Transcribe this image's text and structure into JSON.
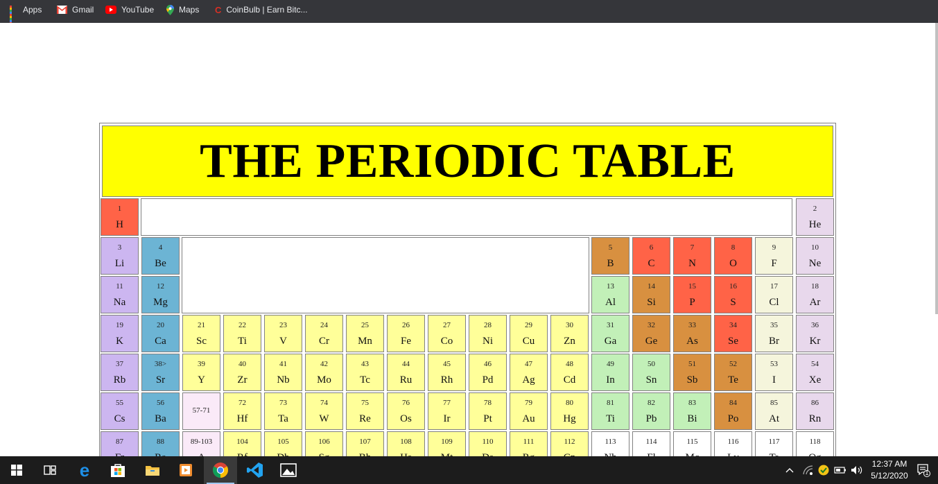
{
  "bookmarks": [
    {
      "label": "Apps",
      "icon": "apps-grid-icon"
    },
    {
      "label": "Gmail",
      "icon": "gmail-icon"
    },
    {
      "label": "YouTube",
      "icon": "youtube-icon"
    },
    {
      "label": "Maps",
      "icon": "maps-icon"
    },
    {
      "label": "CoinBulb | Earn Bitc...",
      "icon": "coinbulb-icon"
    }
  ],
  "page": {
    "title": "THE PERIODIC TABLE",
    "colors": {
      "red": "#ff6347",
      "purple": "#ccb6f0",
      "blue": "#6cb4d4",
      "yellow": "#ffff99",
      "orange": "#d89040",
      "green": "#c2f0b8",
      "cream": "#f5f5dc",
      "lavender": "#e8d8ec",
      "pink": "#faeaf8",
      "white": "#ffffff"
    },
    "elements": [
      {
        "num": "1",
        "sym": "H",
        "row": 0,
        "col": 0,
        "color": "red"
      },
      {
        "num": "2",
        "sym": "He",
        "row": 0,
        "col": 17,
        "color": "lavender"
      },
      {
        "num": "3",
        "sym": "Li",
        "row": 1,
        "col": 0,
        "color": "purple"
      },
      {
        "num": "4",
        "sym": "Be",
        "row": 1,
        "col": 1,
        "color": "blue"
      },
      {
        "num": "5",
        "sym": "B",
        "row": 1,
        "col": 12,
        "color": "orange"
      },
      {
        "num": "6",
        "sym": "C",
        "row": 1,
        "col": 13,
        "color": "red"
      },
      {
        "num": "7",
        "sym": "N",
        "row": 1,
        "col": 14,
        "color": "red"
      },
      {
        "num": "8",
        "sym": "O",
        "row": 1,
        "col": 15,
        "color": "red"
      },
      {
        "num": "9",
        "sym": "F",
        "row": 1,
        "col": 16,
        "color": "cream"
      },
      {
        "num": "10",
        "sym": "Ne",
        "row": 1,
        "col": 17,
        "color": "lavender"
      },
      {
        "num": "11",
        "sym": "Na",
        "row": 2,
        "col": 0,
        "color": "purple"
      },
      {
        "num": "12",
        "sym": "Mg",
        "row": 2,
        "col": 1,
        "color": "blue"
      },
      {
        "num": "13",
        "sym": "Al",
        "row": 2,
        "col": 12,
        "color": "green"
      },
      {
        "num": "14",
        "sym": "Si",
        "row": 2,
        "col": 13,
        "color": "orange"
      },
      {
        "num": "15",
        "sym": "P",
        "row": 2,
        "col": 14,
        "color": "red"
      },
      {
        "num": "16",
        "sym": "S",
        "row": 2,
        "col": 15,
        "color": "red"
      },
      {
        "num": "17",
        "sym": "Cl",
        "row": 2,
        "col": 16,
        "color": "cream"
      },
      {
        "num": "18",
        "sym": "Ar",
        "row": 2,
        "col": 17,
        "color": "lavender"
      },
      {
        "num": "19",
        "sym": "K",
        "row": 3,
        "col": 0,
        "color": "purple"
      },
      {
        "num": "20",
        "sym": "Ca",
        "row": 3,
        "col": 1,
        "color": "blue"
      },
      {
        "num": "21",
        "sym": "Sc",
        "row": 3,
        "col": 2,
        "color": "yellow"
      },
      {
        "num": "22",
        "sym": "Ti",
        "row": 3,
        "col": 3,
        "color": "yellow"
      },
      {
        "num": "23",
        "sym": "V",
        "row": 3,
        "col": 4,
        "color": "yellow"
      },
      {
        "num": "24",
        "sym": "Cr",
        "row": 3,
        "col": 5,
        "color": "yellow"
      },
      {
        "num": "25",
        "sym": "Mn",
        "row": 3,
        "col": 6,
        "color": "yellow"
      },
      {
        "num": "26",
        "sym": "Fe",
        "row": 3,
        "col": 7,
        "color": "yellow"
      },
      {
        "num": "27",
        "sym": "Co",
        "row": 3,
        "col": 8,
        "color": "yellow"
      },
      {
        "num": "28",
        "sym": "Ni",
        "row": 3,
        "col": 9,
        "color": "yellow"
      },
      {
        "num": "29",
        "sym": "Cu",
        "row": 3,
        "col": 10,
        "color": "yellow"
      },
      {
        "num": "30",
        "sym": "Zn",
        "row": 3,
        "col": 11,
        "color": "yellow"
      },
      {
        "num": "31",
        "sym": "Ga",
        "row": 3,
        "col": 12,
        "color": "green"
      },
      {
        "num": "32",
        "sym": "Ge",
        "row": 3,
        "col": 13,
        "color": "orange"
      },
      {
        "num": "33",
        "sym": "As",
        "row": 3,
        "col": 14,
        "color": "orange"
      },
      {
        "num": "34",
        "sym": "Se",
        "row": 3,
        "col": 15,
        "color": "red"
      },
      {
        "num": "35",
        "sym": "Br",
        "row": 3,
        "col": 16,
        "color": "cream"
      },
      {
        "num": "36",
        "sym": "Kr",
        "row": 3,
        "col": 17,
        "color": "lavender"
      },
      {
        "num": "37",
        "sym": "Rb",
        "row": 4,
        "col": 0,
        "color": "purple"
      },
      {
        "num": "38>",
        "sym": "Sr",
        "row": 4,
        "col": 1,
        "color": "blue"
      },
      {
        "num": "39",
        "sym": "Y",
        "row": 4,
        "col": 2,
        "color": "yellow"
      },
      {
        "num": "40",
        "sym": "Zr",
        "row": 4,
        "col": 3,
        "color": "yellow"
      },
      {
        "num": "41",
        "sym": "Nb",
        "row": 4,
        "col": 4,
        "color": "yellow"
      },
      {
        "num": "42",
        "sym": "Mo",
        "row": 4,
        "col": 5,
        "color": "yellow"
      },
      {
        "num": "43",
        "sym": "Tc",
        "row": 4,
        "col": 6,
        "color": "yellow"
      },
      {
        "num": "44",
        "sym": "Ru",
        "row": 4,
        "col": 7,
        "color": "yellow"
      },
      {
        "num": "45",
        "sym": "Rh",
        "row": 4,
        "col": 8,
        "color": "yellow"
      },
      {
        "num": "46",
        "sym": "Pd",
        "row": 4,
        "col": 9,
        "color": "yellow"
      },
      {
        "num": "47",
        "sym": "Ag",
        "row": 4,
        "col": 10,
        "color": "yellow"
      },
      {
        "num": "48",
        "sym": "Cd",
        "row": 4,
        "col": 11,
        "color": "yellow"
      },
      {
        "num": "49",
        "sym": "In",
        "row": 4,
        "col": 12,
        "color": "green"
      },
      {
        "num": "50",
        "sym": "Sn",
        "row": 4,
        "col": 13,
        "color": "green"
      },
      {
        "num": "51",
        "sym": "Sb",
        "row": 4,
        "col": 14,
        "color": "orange"
      },
      {
        "num": "52",
        "sym": "Te",
        "row": 4,
        "col": 15,
        "color": "orange"
      },
      {
        "num": "53",
        "sym": "I",
        "row": 4,
        "col": 16,
        "color": "cream"
      },
      {
        "num": "54",
        "sym": "Xe",
        "row": 4,
        "col": 17,
        "color": "lavender"
      },
      {
        "num": "55",
        "sym": "Cs",
        "row": 5,
        "col": 0,
        "color": "purple"
      },
      {
        "num": "56",
        "sym": "Ba",
        "row": 5,
        "col": 1,
        "color": "blue"
      },
      {
        "num": "57-71",
        "sym": "",
        "row": 5,
        "col": 2,
        "color": "pink"
      },
      {
        "num": "72",
        "sym": "Hf",
        "row": 5,
        "col": 3,
        "color": "yellow"
      },
      {
        "num": "73",
        "sym": "Ta",
        "row": 5,
        "col": 4,
        "color": "yellow"
      },
      {
        "num": "74",
        "sym": "W",
        "row": 5,
        "col": 5,
        "color": "yellow"
      },
      {
        "num": "75",
        "sym": "Re",
        "row": 5,
        "col": 6,
        "color": "yellow"
      },
      {
        "num": "76",
        "sym": "Os",
        "row": 5,
        "col": 7,
        "color": "yellow"
      },
      {
        "num": "77",
        "sym": "Ir",
        "row": 5,
        "col": 8,
        "color": "yellow"
      },
      {
        "num": "78",
        "sym": "Pt",
        "row": 5,
        "col": 9,
        "color": "yellow"
      },
      {
        "num": "79",
        "sym": "Au",
        "row": 5,
        "col": 10,
        "color": "yellow"
      },
      {
        "num": "80",
        "sym": "Hg",
        "row": 5,
        "col": 11,
        "color": "yellow"
      },
      {
        "num": "81",
        "sym": "Ti",
        "row": 5,
        "col": 12,
        "color": "green"
      },
      {
        "num": "82",
        "sym": "Pb",
        "row": 5,
        "col": 13,
        "color": "green"
      },
      {
        "num": "83",
        "sym": "Bi",
        "row": 5,
        "col": 14,
        "color": "green"
      },
      {
        "num": "84",
        "sym": "Po",
        "row": 5,
        "col": 15,
        "color": "orange"
      },
      {
        "num": "85",
        "sym": "At",
        "row": 5,
        "col": 16,
        "color": "cream"
      },
      {
        "num": "86",
        "sym": "Rn",
        "row": 5,
        "col": 17,
        "color": "lavender"
      },
      {
        "num": "87",
        "sym": "Fr",
        "row": 6,
        "col": 0,
        "color": "purple"
      },
      {
        "num": "88",
        "sym": "Ra",
        "row": 6,
        "col": 1,
        "color": "blue"
      },
      {
        "num": "89-103",
        "sym": "A",
        "row": 6,
        "col": 2,
        "color": "pink"
      },
      {
        "num": "104",
        "sym": "Rf",
        "row": 6,
        "col": 3,
        "color": "yellow"
      },
      {
        "num": "105",
        "sym": "Db",
        "row": 6,
        "col": 4,
        "color": "yellow"
      },
      {
        "num": "106",
        "sym": "Sg",
        "row": 6,
        "col": 5,
        "color": "yellow"
      },
      {
        "num": "107",
        "sym": "Bh",
        "row": 6,
        "col": 6,
        "color": "yellow"
      },
      {
        "num": "108",
        "sym": "Hs",
        "row": 6,
        "col": 7,
        "color": "yellow"
      },
      {
        "num": "109",
        "sym": "Mt",
        "row": 6,
        "col": 8,
        "color": "yellow"
      },
      {
        "num": "110",
        "sym": "Ds",
        "row": 6,
        "col": 9,
        "color": "yellow"
      },
      {
        "num": "111",
        "sym": "Rg",
        "row": 6,
        "col": 10,
        "color": "yellow"
      },
      {
        "num": "112",
        "sym": "Cn",
        "row": 6,
        "col": 11,
        "color": "yellow"
      },
      {
        "num": "113",
        "sym": "Nh",
        "row": 6,
        "col": 12,
        "color": "white"
      },
      {
        "num": "114",
        "sym": "Fl",
        "row": 6,
        "col": 13,
        "color": "white"
      },
      {
        "num": "115",
        "sym": "Mc",
        "row": 6,
        "col": 14,
        "color": "white"
      },
      {
        "num": "116",
        "sym": "Lv",
        "row": 6,
        "col": 15,
        "color": "white"
      },
      {
        "num": "117",
        "sym": "Ts",
        "row": 6,
        "col": 16,
        "color": "white"
      },
      {
        "num": "118",
        "sym": "Og",
        "row": 6,
        "col": 17,
        "color": "white"
      }
    ]
  },
  "taskbar": {
    "apps": [
      "start-icon",
      "task-view-icon",
      "edge-icon",
      "store-icon",
      "file-explorer-icon",
      "media-player-icon",
      "chrome-icon",
      "vscode-icon",
      "photos-icon"
    ],
    "active": "chrome-icon",
    "tray": {
      "time": "12:37 AM",
      "date": "5/12/2020",
      "notification_count": "1"
    }
  }
}
